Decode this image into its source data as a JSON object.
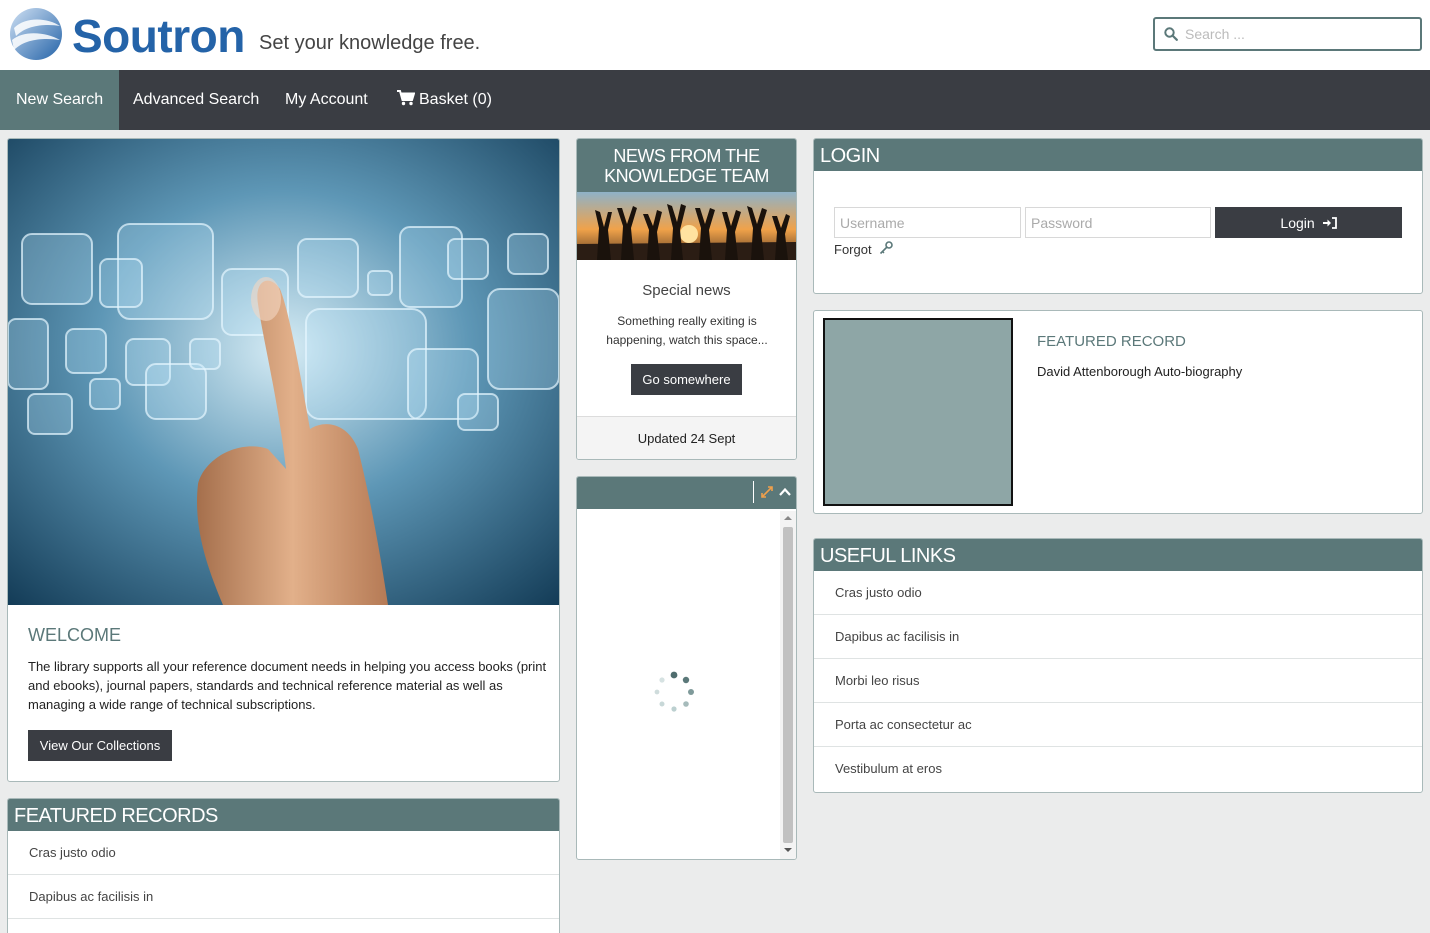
{
  "brand": {
    "name": "Soutron",
    "tagline": "Set your knowledge free."
  },
  "search": {
    "placeholder": "Search ..."
  },
  "nav": {
    "new_search": "New Search",
    "advanced_search": "Advanced Search",
    "my_account": "My Account",
    "basket": "Basket (0)"
  },
  "welcome": {
    "title": "WELCOME",
    "text": "The library supports all your reference document needs in helping you access books (print and ebooks), journal papers, standards and technical reference material as well as managing a wide range of technical subscriptions.",
    "button": "View Our Collections"
  },
  "featured_records": {
    "title": "FEATURED RECORDS",
    "items": [
      "Cras justo odio",
      "Dapibus ac facilisis in"
    ]
  },
  "news": {
    "title": "NEWS FROM THE KNOWLEDGE TEAM",
    "heading": "Special news",
    "text": "Something really exiting is happening, watch this space...",
    "button": "Go somewhere",
    "footer": "Updated 24 Sept"
  },
  "login": {
    "title": "LOGIN",
    "username_placeholder": "Username",
    "password_placeholder": "Password",
    "button": "Login",
    "forgot": "Forgot"
  },
  "featured_record": {
    "label": "FEATURED RECORD",
    "title": "David Attenborough Auto-biography"
  },
  "useful_links": {
    "title": "USEFUL LINKS",
    "items": [
      "Cras justo odio",
      "Dapibus ac facilisis in",
      "Morbi leo risus",
      "Porta ac consectetur ac",
      "Vestibulum at eros"
    ]
  },
  "colors": {
    "brand_blue": "#2463a8",
    "teal": "#5b7879",
    "dark": "#3a3d43"
  }
}
